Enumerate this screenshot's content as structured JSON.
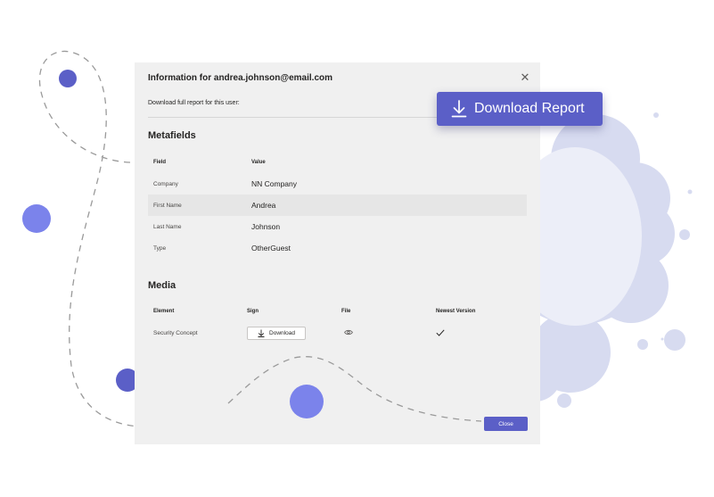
{
  "colors": {
    "accent": "#5b5fc7",
    "blob": "#d7dbf0",
    "blob_inner": "#eceef8",
    "dot_dark": "#5b5fc7",
    "dot_light": "#7b83eb"
  },
  "dialog": {
    "title_prefix": "Information for ",
    "title_email": "andrea.johnson@email.com",
    "close_icon": "close-icon",
    "subtitle": "Download full report for this user:"
  },
  "report_button": {
    "label": "Download Report",
    "icon": "download-icon"
  },
  "metafields": {
    "title": "Metafields",
    "col_field": "Field",
    "col_value": "Value",
    "rows": [
      {
        "field": "Company",
        "value": "NN Company"
      },
      {
        "field": "First Name",
        "value": "Andrea"
      },
      {
        "field": "Last Name",
        "value": "Johnson"
      },
      {
        "field": "Type",
        "value": "OtherGuest"
      }
    ]
  },
  "media": {
    "title": "Media",
    "col_element": "Element",
    "col_sign": "Sign",
    "col_file": "File",
    "col_newest": "Newest Version",
    "row": {
      "element": "Security Concept",
      "sign_label": "Download",
      "file_icon": "eye-icon",
      "newest_icon": "checkmark-icon"
    }
  },
  "footer": {
    "close_label": "Close"
  }
}
